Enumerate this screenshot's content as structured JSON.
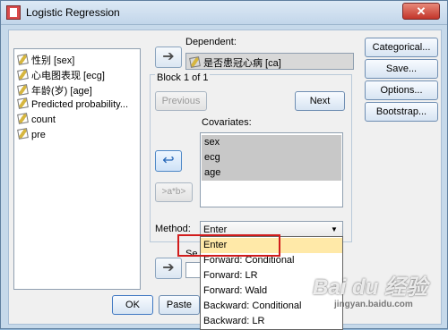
{
  "window": {
    "title": "Logistic Regression",
    "close_glyph": "✕"
  },
  "variables": [
    "性别 [sex]",
    "心电图表现 [ecg]",
    "年龄(岁) [age]",
    "Predicted probability...",
    "count",
    "pre"
  ],
  "dependent": {
    "label": "Dependent:",
    "value": "是否患冠心病 [ca]"
  },
  "block": {
    "label": "Block 1 of 1",
    "previous": "Previous",
    "next": "Next"
  },
  "covariates": {
    "label": "Covariates:",
    "items": [
      "sex",
      "ecg",
      "age"
    ],
    "interaction": ">a*b>"
  },
  "method": {
    "label": "Method:",
    "value": "Enter",
    "options": [
      "Enter",
      "Forward: Conditional",
      "Forward: LR",
      "Forward: Wald",
      "Backward: Conditional",
      "Backward: LR"
    ]
  },
  "selection_label_partial": "Se",
  "side_buttons": [
    "Categorical...",
    "Save...",
    "Options...",
    "Bootstrap..."
  ],
  "bottom_buttons": {
    "ok": "OK",
    "paste": "Paste"
  },
  "watermark": {
    "main": "Bai du 经验",
    "sub": "jingyan.baidu.com"
  }
}
